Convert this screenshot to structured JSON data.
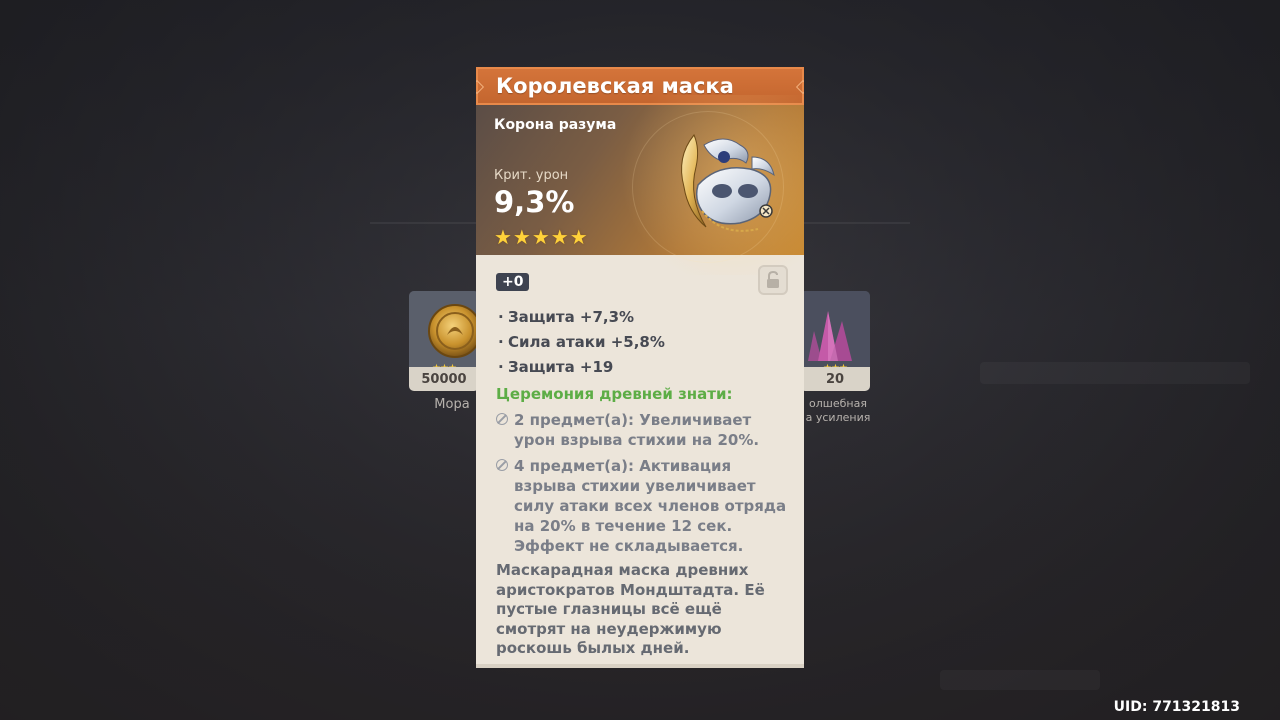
{
  "artifact": {
    "name": "Королевская маска",
    "slot": "Корона разума",
    "main_stat": {
      "label": "Крит. урон",
      "value": "9,3%"
    },
    "rarity_stars": "★★★★★",
    "level": "+0",
    "substats": [
      {
        "text": "Защита +7,3%"
      },
      {
        "text": "Сила атаки +5,8%"
      },
      {
        "text": "Защита +19"
      }
    ],
    "set": {
      "name": "Церемония древней знати:",
      "bonuses": [
        {
          "text": "2 предмет(а): Увеличивает урон взрыва стихии на 20%."
        },
        {
          "text": "4 предмет(а): Активация взрыва стихии увеличивает силу атаки всех членов отряда на 20% в течение 12 сек. Эффект не складывается."
        }
      ]
    },
    "description": "Маскарадная маска древних аристократов Мондштадта. Её пустые глазницы всё ещё смотрят на неудержимую роскошь былых дней."
  },
  "background_items": [
    {
      "count": "50000",
      "label": "Мора",
      "stars": "★★★"
    },
    {
      "count": "20",
      "label": "олшебная\nа усиления",
      "stars": "★★★"
    }
  ],
  "uid": "UID: 771321813",
  "icons": [
    "lock-icon",
    "set-piece-icon",
    "mora-coin-icon",
    "crystal-ore-icon",
    "mask-artifact-icon"
  ],
  "colors": {
    "title_bar": "#c8692f",
    "set_name": "#5dad46",
    "star": "#ffd23a",
    "card_bg": "#ece5da"
  }
}
